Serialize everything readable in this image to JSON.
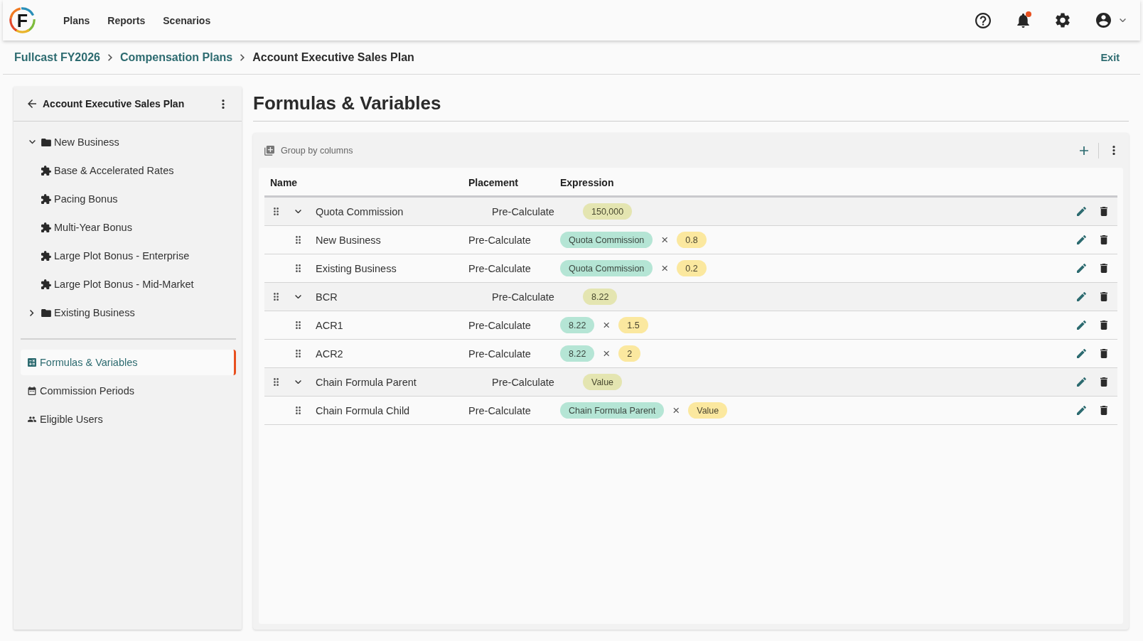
{
  "header": {
    "logo_text": "F",
    "nav": [
      {
        "label": "Plans"
      },
      {
        "label": "Reports"
      },
      {
        "label": "Scenarios"
      }
    ],
    "notifications_unread": true
  },
  "breadcrumb": {
    "items": [
      {
        "label": "Fullcast FY2026",
        "kind": "link"
      },
      {
        "label": "Compensation Plans",
        "kind": "link"
      },
      {
        "label": "Account Executive Sales Plan",
        "kind": "current"
      }
    ],
    "exit_label": "Exit"
  },
  "sidebar": {
    "title": "Account Executive Sales Plan",
    "tree": [
      {
        "label": "New Business",
        "kind": "folder",
        "expanded": true,
        "children": [
          {
            "label": "Base & Accelerated Rates",
            "kind": "component"
          },
          {
            "label": "Pacing Bonus",
            "kind": "component"
          },
          {
            "label": "Multi-Year Bonus",
            "kind": "component"
          },
          {
            "label": "Large Plot Bonus - Enterprise",
            "kind": "component"
          },
          {
            "label": "Large Plot Bonus - Mid-Market",
            "kind": "component"
          }
        ]
      },
      {
        "label": "Existing Business",
        "kind": "folder",
        "expanded": false
      }
    ],
    "nav": [
      {
        "label": "Formulas & Variables",
        "selected": true
      },
      {
        "label": "Commission Periods",
        "selected": false
      },
      {
        "label": "Eligible Users",
        "selected": false
      }
    ]
  },
  "page_title": "Formulas & Variables",
  "table": {
    "toolbar_label": "Group by columns",
    "columns": [
      "Name",
      "Placement",
      "Expression"
    ],
    "rows": [
      {
        "name": "Quota Commission",
        "placement": "Pre-Calculate",
        "expanded": true,
        "expression": [
          {
            "kind": "value",
            "text": "150,000"
          }
        ],
        "children": [
          {
            "name": "New Business",
            "placement": "Pre-Calculate",
            "expression": [
              {
                "kind": "reference",
                "text": "Quota Commission"
              },
              {
                "kind": "operator",
                "text": "×"
              },
              {
                "kind": "constant",
                "text": "0.8"
              }
            ]
          },
          {
            "name": "Existing Business",
            "placement": "Pre-Calculate",
            "expression": [
              {
                "kind": "reference",
                "text": "Quota Commission"
              },
              {
                "kind": "operator",
                "text": "×"
              },
              {
                "kind": "constant",
                "text": "0.2"
              }
            ]
          }
        ]
      },
      {
        "name": "BCR",
        "placement": "Pre-Calculate",
        "expanded": true,
        "expression": [
          {
            "kind": "value",
            "text": "8.22"
          }
        ],
        "children": [
          {
            "name": "ACR1",
            "placement": "Pre-Calculate",
            "expression": [
              {
                "kind": "reference",
                "text": "8.22"
              },
              {
                "kind": "operator",
                "text": "×"
              },
              {
                "kind": "constant",
                "text": "1.5"
              }
            ]
          },
          {
            "name": "ACR2",
            "placement": "Pre-Calculate",
            "expression": [
              {
                "kind": "reference",
                "text": "8.22"
              },
              {
                "kind": "operator",
                "text": "×"
              },
              {
                "kind": "constant",
                "text": "2"
              }
            ]
          }
        ]
      },
      {
        "name": "Chain Formula Parent",
        "placement": "Pre-Calculate",
        "expanded": true,
        "expression": [
          {
            "kind": "value",
            "text": "Value"
          }
        ],
        "children": [
          {
            "name": "Chain Formula Child",
            "placement": "Pre-Calculate",
            "expression": [
              {
                "kind": "reference",
                "text": "Chain Formula Parent"
              },
              {
                "kind": "operator",
                "text": "×"
              },
              {
                "kind": "constant",
                "text": "Value"
              }
            ]
          }
        ]
      }
    ]
  }
}
